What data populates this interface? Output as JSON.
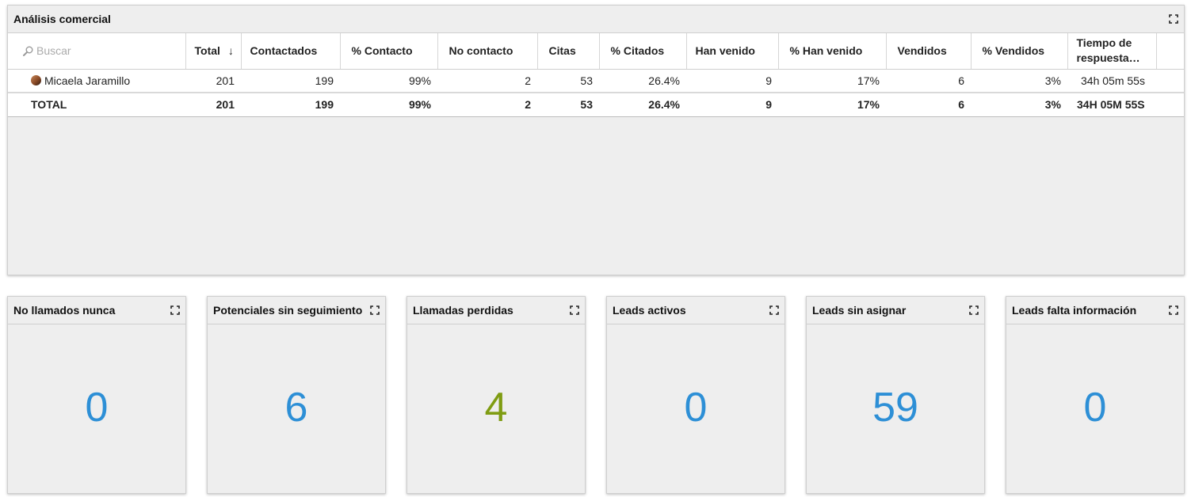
{
  "main_panel": {
    "title": "Análisis comercial",
    "search_placeholder": "Buscar",
    "columns": [
      "Total",
      "Contactados",
      "% Contacto",
      "No contacto",
      "Citas",
      "% Citados",
      "Han venido",
      "% Han venido",
      "Vendidos",
      "% Vendidos",
      "Tiempo de respuesta…"
    ],
    "sort_arrow": "↓",
    "rows": [
      {
        "name": "Micaela Jaramillo",
        "cells": [
          "201",
          "199",
          "99%",
          "2",
          "53",
          "26.4%",
          "9",
          "17%",
          "6",
          "3%",
          "34h 05m 55s"
        ]
      }
    ],
    "total": {
      "name": "TOTAL",
      "cells": [
        "201",
        "199",
        "99%",
        "2",
        "53",
        "26.4%",
        "9",
        "17%",
        "6",
        "3%",
        "34H 05M 55S"
      ]
    }
  },
  "kpis": [
    {
      "title": "No llamados nunca",
      "value": "0",
      "color": "#2d8fd6"
    },
    {
      "title": "Potenciales sin seguimiento",
      "value": "6",
      "color": "#2d8fd6"
    },
    {
      "title": "Llamadas perdidas",
      "value": "4",
      "color": "#7f9c12"
    },
    {
      "title": "Leads activos",
      "value": "0",
      "color": "#2d8fd6"
    },
    {
      "title": "Leads sin asignar",
      "value": "59",
      "color": "#2d8fd6"
    },
    {
      "title": "Leads falta información",
      "value": "0",
      "color": "#2d8fd6"
    }
  ],
  "icons": {
    "expand": "expand-icon",
    "search": "search-icon",
    "avatar": "avatar"
  }
}
